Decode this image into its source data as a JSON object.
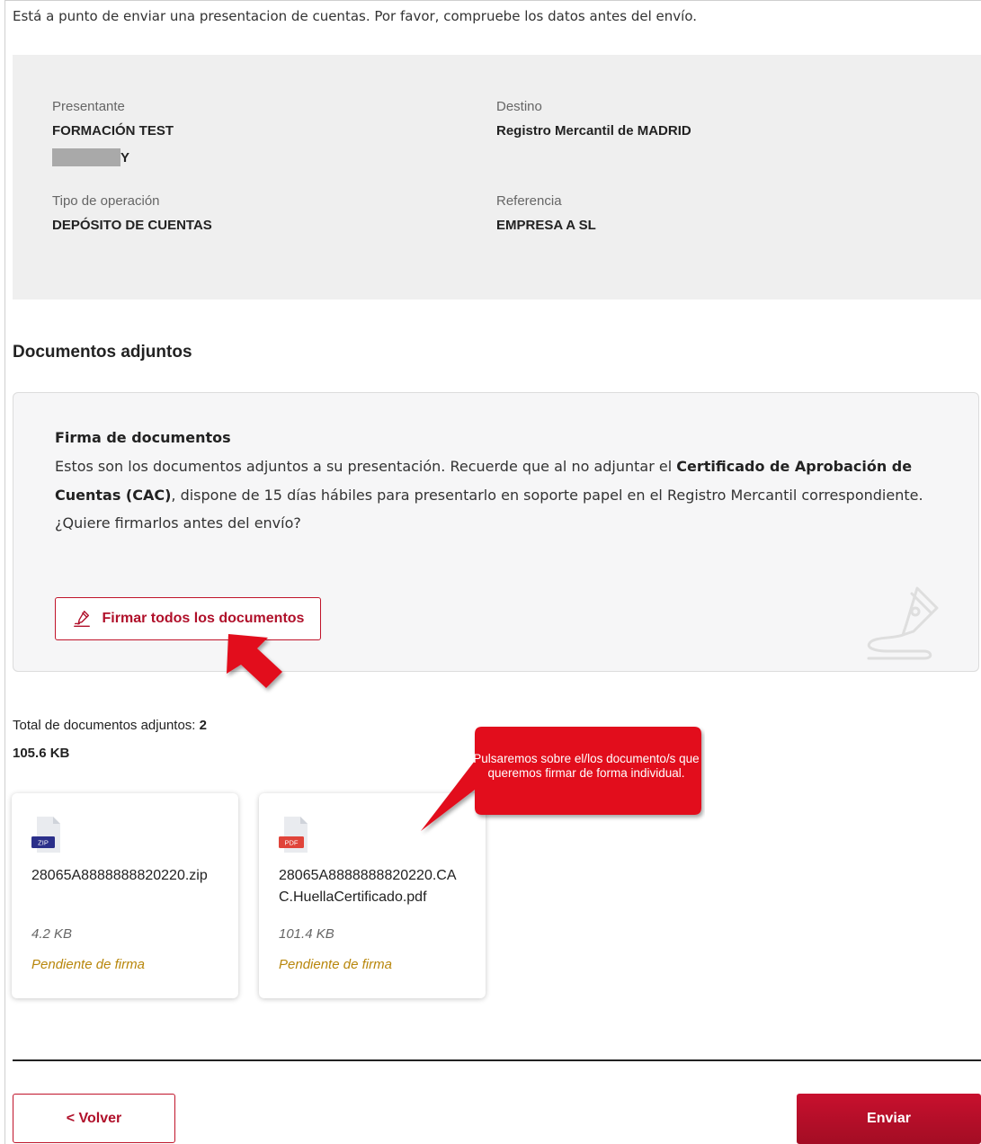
{
  "intro": "Está a punto de enviar una presentacion de cuentas. Por favor, compruebe los datos antes del envío.",
  "summary": {
    "presentante_label": "Presentante",
    "presentante_value": "FORMACIÓN TEST",
    "presentante_id_tail": "Y",
    "destino_label": "Destino",
    "destino_value": "Registro Mercantil de MADRID",
    "tipo_label": "Tipo de operación",
    "tipo_value": "DEPÓSITO DE CUENTAS",
    "referencia_label": "Referencia",
    "referencia_value": "EMPRESA A SL"
  },
  "attachments": {
    "title": "Documentos adjuntos",
    "sign_panel": {
      "title": "Firma de documentos",
      "text_1": "Estos son los documentos adjuntos a su presentación. Recuerde que al no adjuntar el ",
      "text_bold": "Certificado de Aprobación de Cuentas (CAC)",
      "text_2": ", dispone de 15 días hábiles para presentarlo en soporte papel en el Registro Mercantil correspondiente.",
      "question": "¿Quiere firmarlos antes del envío?",
      "sign_all_label": "Firmar todos los documentos"
    },
    "total_label": "Total de documentos adjuntos:",
    "total_count": "2",
    "total_size": "105.6 KB",
    "files": [
      {
        "type": "ZIP",
        "name": "28065A8888888820220.zip",
        "size": "4.2 KB",
        "status": "Pendiente de firma",
        "color": "#2b2f8a"
      },
      {
        "type": "PDF",
        "name": "28065A8888888820220.CAC.HuellaCertificado.pdf",
        "size": "101.4 KB",
        "status": "Pendiente de firma",
        "color": "#e0443a"
      }
    ]
  },
  "callout": "Pulsaremos sobre el/los documento/s que queremos firmar de forma individual.",
  "footer": {
    "back_label": "< Volver",
    "send_label": "Enviar"
  },
  "colors": {
    "accent": "#c0142a",
    "pending": "#b8860b",
    "info_bg": "#efefef"
  }
}
